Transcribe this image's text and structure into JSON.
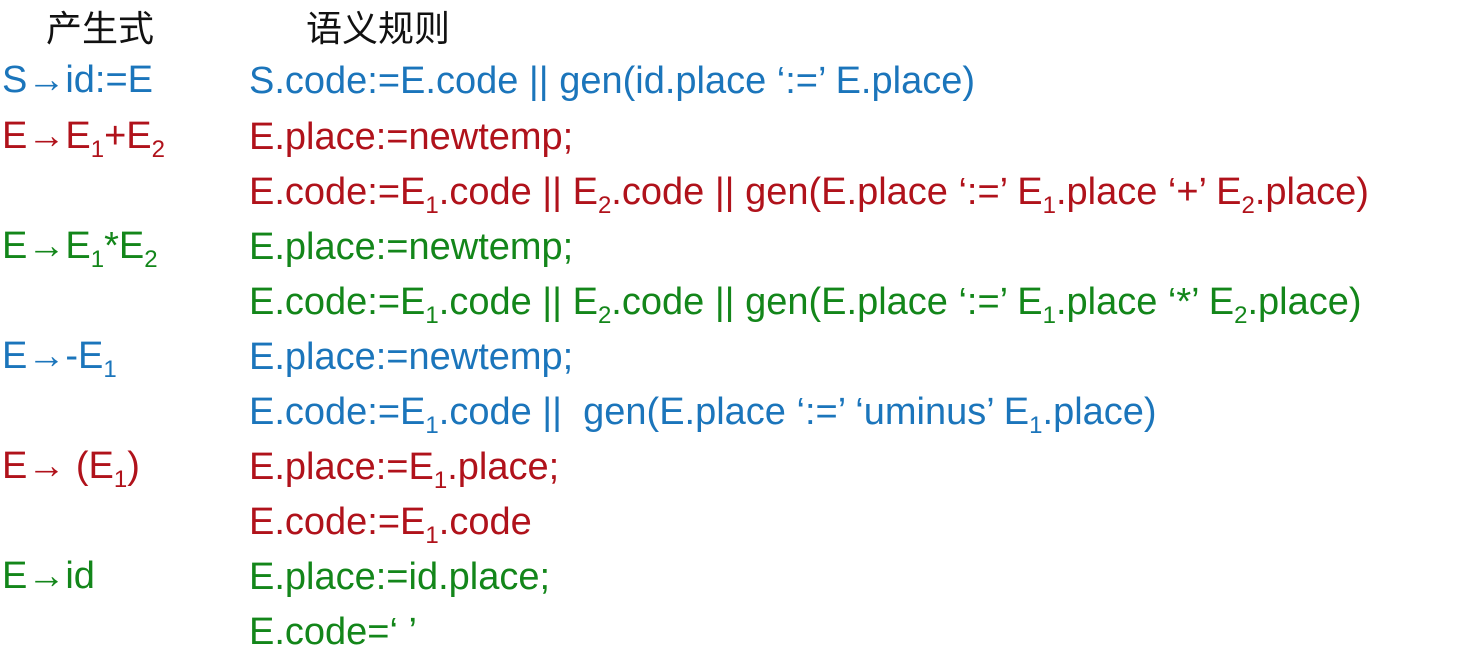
{
  "header": {
    "production_label": "产生式",
    "rule_label": "语义规则"
  },
  "colors": {
    "blue": "#1b75bb",
    "red": "#b0121b",
    "green": "#13861a",
    "header": "#111111"
  },
  "rows": [
    {
      "color": "blue",
      "production": [
        {
          "t": "S→id:=E"
        }
      ],
      "rules": [
        [
          {
            "t": "S.code:=E.code || gen(id.place ‘:=’ E.place)"
          }
        ]
      ]
    },
    {
      "color": "red",
      "production": [
        {
          "t": "E→E"
        },
        {
          "s": "1"
        },
        {
          "t": "+E"
        },
        {
          "s": "2"
        }
      ],
      "rules": [
        [
          {
            "t": "E.place:=newtemp;"
          }
        ],
        [
          {
            "t": "E.code:=E"
          },
          {
            "s": "1"
          },
          {
            "t": ".code || E"
          },
          {
            "s": "2"
          },
          {
            "t": ".code || gen(E.place ‘:=’ E"
          },
          {
            "s": "1"
          },
          {
            "t": ".place ‘+’ E"
          },
          {
            "s": "2"
          },
          {
            "t": ".place)"
          }
        ]
      ]
    },
    {
      "color": "green",
      "production": [
        {
          "t": "E→E"
        },
        {
          "s": "1"
        },
        {
          "t": "*E"
        },
        {
          "s": "2"
        }
      ],
      "rules": [
        [
          {
            "t": "E.place:=newtemp;"
          }
        ],
        [
          {
            "t": "E.code:=E"
          },
          {
            "s": "1"
          },
          {
            "t": ".code || E"
          },
          {
            "s": "2"
          },
          {
            "t": ".code || gen(E.place ‘:=’ E"
          },
          {
            "s": "1"
          },
          {
            "t": ".place ‘*’ E"
          },
          {
            "s": "2"
          },
          {
            "t": ".place)"
          }
        ]
      ]
    },
    {
      "color": "blue",
      "production": [
        {
          "t": "E→-E"
        },
        {
          "s": "1"
        }
      ],
      "rules": [
        [
          {
            "t": "E.place:=newtemp;"
          }
        ],
        [
          {
            "t": "E.code:=E"
          },
          {
            "s": "1"
          },
          {
            "t": ".code ||  gen(E.place ‘:=’ ‘uminus’ E"
          },
          {
            "s": "1"
          },
          {
            "t": ".place)"
          }
        ]
      ]
    },
    {
      "color": "red",
      "production": [
        {
          "t": "E→ (E"
        },
        {
          "s": "1"
        },
        {
          "t": ")"
        }
      ],
      "rules": [
        [
          {
            "t": "E.place:=E"
          },
          {
            "s": "1"
          },
          {
            "t": ".place;"
          }
        ],
        [
          {
            "t": "E.code:=E"
          },
          {
            "s": "1"
          },
          {
            "t": ".code"
          }
        ]
      ]
    },
    {
      "color": "green",
      "production": [
        {
          "t": "E→id"
        }
      ],
      "rules": [
        [
          {
            "t": "E.place:=id.place;"
          }
        ],
        [
          {
            "t": "E.code=‘ ’"
          }
        ]
      ]
    }
  ]
}
